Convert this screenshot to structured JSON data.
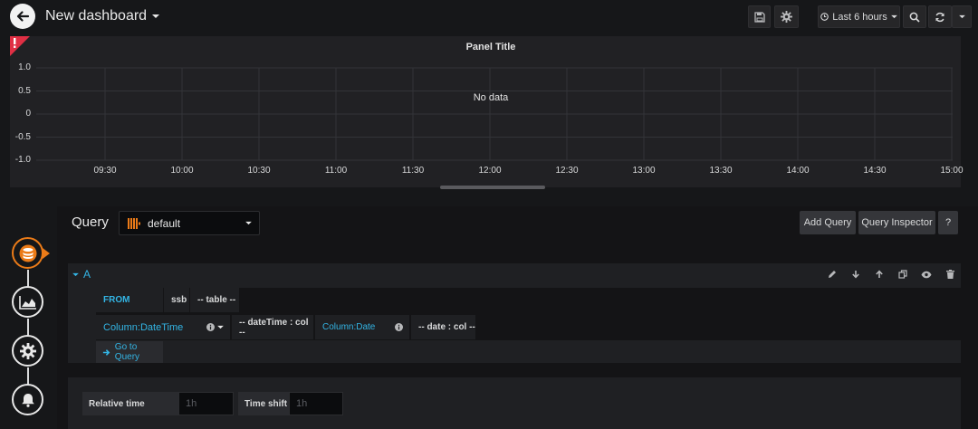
{
  "header": {
    "title": "New dashboard",
    "time_range": "Last 6 hours"
  },
  "panel": {
    "title": "Panel Title",
    "no_data": "No data",
    "error_icon": "!"
  },
  "chart_data": {
    "type": "line",
    "title": "Panel Title",
    "xlabel": "",
    "ylabel": "",
    "x_ticks": [
      "09:30",
      "10:00",
      "10:30",
      "11:00",
      "11:30",
      "12:00",
      "12:30",
      "13:00",
      "13:30",
      "14:00",
      "14:30",
      "15:00"
    ],
    "y_ticks": [
      "1.0",
      "0.5",
      "0",
      "-0.5",
      "-1.0"
    ],
    "ylim": [
      -1.0,
      1.0
    ],
    "grid": true,
    "series": [],
    "annotation": "No data"
  },
  "editor": {
    "query_label": "Query",
    "datasource": "default",
    "add_query_label": "Add Query",
    "query_inspector_label": "Query Inspector",
    "help_label": "?",
    "row_name": "A",
    "from_kw": "FROM",
    "database": "ssb",
    "table": "-- table --",
    "datetime_type": "Column:DateTime",
    "datetime_col": "-- dateTime : col --",
    "date_type": "Column:Date",
    "date_col": "-- date : col --",
    "go_to_query": "Go to Query",
    "relative_time_label": "Relative time",
    "relative_time_placeholder": "1h",
    "time_shift_label": "Time shift",
    "time_shift_placeholder": "1h"
  },
  "colors": {
    "accent": "#33b5e5",
    "active_ring": "#eb7b18",
    "error": "#e02f44",
    "datasource_icon": "#eb7b18"
  }
}
